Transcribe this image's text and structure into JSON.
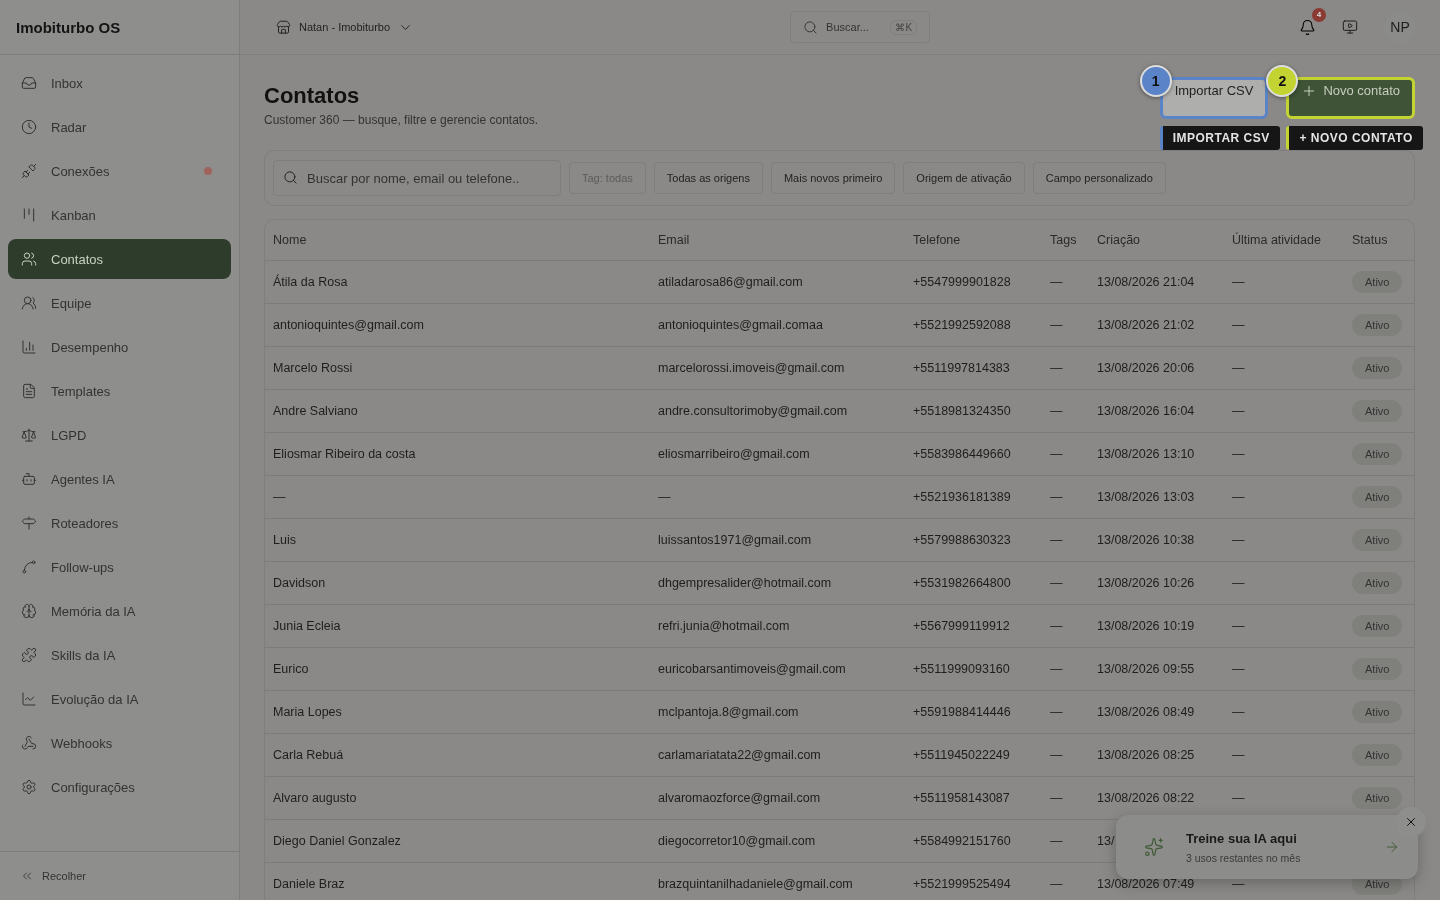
{
  "app": {
    "name": "Imobiturbo OS"
  },
  "sidebar": {
    "items": [
      {
        "label": "Inbox",
        "selected": false,
        "alert": false
      },
      {
        "label": "Radar",
        "selected": false,
        "alert": false
      },
      {
        "label": "Conexões",
        "selected": false,
        "alert": true
      },
      {
        "label": "Kanban",
        "selected": false,
        "alert": false
      },
      {
        "label": "Contatos",
        "selected": true,
        "alert": false
      },
      {
        "label": "Equipe",
        "selected": false,
        "alert": false
      },
      {
        "label": "Desempenho",
        "selected": false,
        "alert": false
      },
      {
        "label": "Templates",
        "selected": false,
        "alert": false
      },
      {
        "label": "LGPD",
        "selected": false,
        "alert": false
      },
      {
        "label": "Agentes IA",
        "selected": false,
        "alert": false
      },
      {
        "label": "Roteadores",
        "selected": false,
        "alert": false
      },
      {
        "label": "Follow-ups",
        "selected": false,
        "alert": false
      },
      {
        "label": "Memória da IA",
        "selected": false,
        "alert": false
      },
      {
        "label": "Skills da IA",
        "selected": false,
        "alert": false
      },
      {
        "label": "Evolução da IA",
        "selected": false,
        "alert": false
      },
      {
        "label": "Webhooks",
        "selected": false,
        "alert": false
      },
      {
        "label": "Configurações",
        "selected": false,
        "alert": false
      }
    ],
    "collapse_label": "Recolher"
  },
  "topbar": {
    "workspace": "Natan - Imobiturbo",
    "search": {
      "placeholder": "Buscar...",
      "shortcut": "⌘K"
    },
    "notifications": "4",
    "avatar": "NP"
  },
  "page": {
    "title": "Contatos",
    "subtitle": "Customer 360 — busque, filtre e gerencie contatos."
  },
  "actions": [
    {
      "kind": "secondary",
      "label": "Importar CSV",
      "step": "1",
      "tour_label": "IMPORTAR CSV",
      "color": "#5b84c8"
    },
    {
      "kind": "primary",
      "label": "Novo contato",
      "step": "2",
      "tour_label": "+ NOVO CONTATO",
      "color": "#c3d432"
    }
  ],
  "filters": {
    "search": {
      "placeholder": "Buscar por nome, email ou telefone.."
    },
    "chips": [
      {
        "label": "Tag: todas",
        "disabled": true
      },
      {
        "label": "Todas as origens",
        "disabled": false
      },
      {
        "label": "Mais novos primeiro",
        "disabled": false
      },
      {
        "label": "Origem de ativação",
        "disabled": false
      },
      {
        "label": "Campo personalizado",
        "disabled": false
      }
    ]
  },
  "table": {
    "columns": [
      "Nome",
      "Email",
      "Telefone",
      "Tags",
      "Criação",
      "Última atividade",
      "Status"
    ],
    "rows": [
      [
        "Átila da Rosa",
        "atiladarosa86@gmail.com",
        "+5547999901828",
        "—",
        "13/08/2026 21:04",
        "—",
        "Ativo"
      ],
      [
        "antonioquintes@gmail.com",
        "antonioquintes@gmail.comaa",
        "+5521992592088",
        "—",
        "13/08/2026 21:02",
        "—",
        "Ativo"
      ],
      [
        "Marcelo Rossi",
        "marcelorossi.imoveis@gmail.com",
        "+5511997814383",
        "—",
        "13/08/2026 20:06",
        "—",
        "Ativo"
      ],
      [
        "Andre Salviano",
        "andre.consultorimoby@gmail.com",
        "+5518981324350",
        "—",
        "13/08/2026 16:04",
        "—",
        "Ativo"
      ],
      [
        "Eliosmar Ribeiro da costa",
        "eliosmarribeiro@gmail.com",
        "+5583986449660",
        "—",
        "13/08/2026 13:10",
        "—",
        "Ativo"
      ],
      [
        "—",
        "—",
        "+5521936181389",
        "—",
        "13/08/2026 13:03",
        "—",
        "Ativo"
      ],
      [
        "Luis",
        "luissantos1971@gmail.com",
        "+5579988630323",
        "—",
        "13/08/2026 10:38",
        "—",
        "Ativo"
      ],
      [
        "Davidson",
        "dhgempresalider@hotmail.com",
        "+5531982664800",
        "—",
        "13/08/2026 10:26",
        "—",
        "Ativo"
      ],
      [
        "Junia Ecleia",
        "refri.junia@hotmail.com",
        "+5567999119912",
        "—",
        "13/08/2026 10:19",
        "—",
        "Ativo"
      ],
      [
        "Eurico",
        "euricobarsantimoveis@gmail.com",
        "+5511999093160",
        "—",
        "13/08/2026 09:55",
        "—",
        "Ativo"
      ],
      [
        "Maria Lopes",
        "mclpantoja.8@gmail.com",
        "+5591988414446",
        "—",
        "13/08/2026 08:49",
        "—",
        "Ativo"
      ],
      [
        "Carla Rebuá",
        "carlamariatata22@gmail.com",
        "+5511945022249",
        "—",
        "13/08/2026 08:25",
        "—",
        "Ativo"
      ],
      [
        "Alvaro augusto",
        "alvaromaozforce@gmail.com",
        "+5511958143087",
        "—",
        "13/08/2026 08:22",
        "—",
        "Ativo"
      ],
      [
        "Diego Daniel Gonzalez",
        "diegocorretor10@gmail.com",
        "+5584992151760",
        "—",
        "13/",
        "",
        ""
      ],
      [
        "Daniele Braz",
        "brazquintanilhadaniele@gmail.com",
        "+5521999525494",
        "—",
        "13/08/2026 07:49",
        "—",
        "Ativo"
      ]
    ]
  },
  "toast": {
    "title": "Treine sua IA aqui",
    "subtitle": "3 usos restantes no mês"
  }
}
